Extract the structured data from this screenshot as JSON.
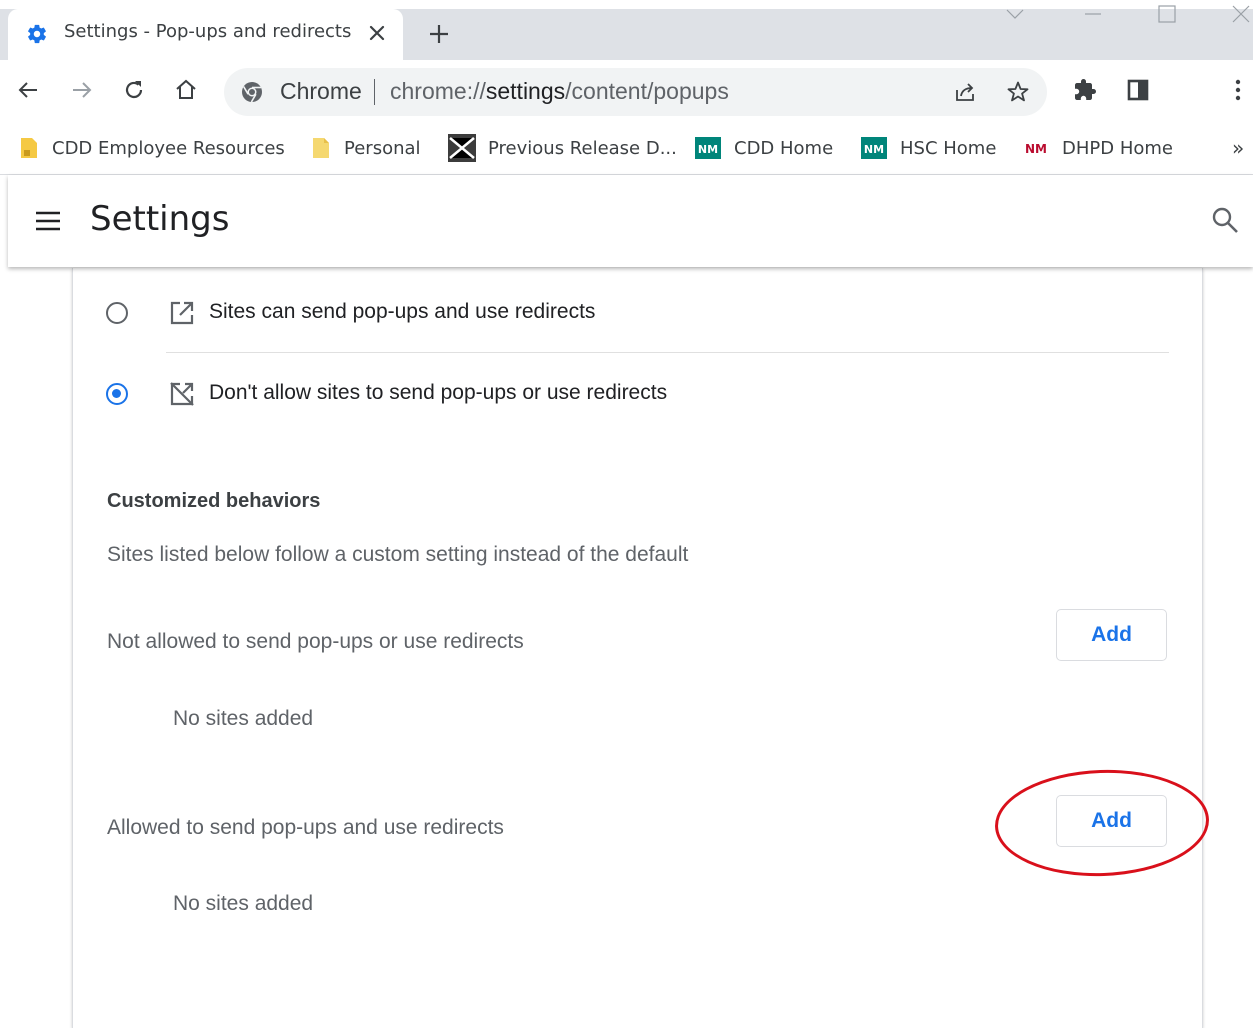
{
  "window": {
    "tab_title": "Settings - Pop-ups and redirects",
    "new_tab_symbol": "+",
    "close_symbol": "✕"
  },
  "toolbar": {
    "site_chip": "Chrome",
    "url_scheme": "chrome://",
    "url_host": "settings",
    "url_path": "/content/popups"
  },
  "bookmarks": [
    {
      "label": "CDD Employee Resources",
      "icon": "folder-icon"
    },
    {
      "label": "Personal",
      "icon": "folder-icon"
    },
    {
      "label": "Previous Release D...",
      "icon": "bookmark-site-icon"
    },
    {
      "label": "CDD Home",
      "icon": "unm-logo-icon"
    },
    {
      "label": "HSC Home",
      "icon": "unm-logo-icon"
    },
    {
      "label": "DHPD Home",
      "icon": "unm-logo-icon"
    }
  ],
  "bookmarks_overflow": "»",
  "settings": {
    "title": "Settings"
  },
  "options": [
    {
      "label": "Sites can send pop-ups and use redirects",
      "selected": false
    },
    {
      "label": "Don't allow sites to send pop-ups or use redirects",
      "selected": true
    }
  ],
  "customized": {
    "title": "Customized behaviors",
    "description": "Sites listed below follow a custom setting instead of the default",
    "blocked_label": "Not allowed to send pop-ups or use redirects",
    "blocked_empty": "No sites added",
    "blocked_add": "Add",
    "allowed_label": "Allowed to send pop-ups and use redirects",
    "allowed_empty": "No sites added",
    "allowed_add": "Add"
  },
  "colors": {
    "accent": "#1a73e8",
    "annotation": "#d9101b",
    "unm_teal": "#00857a",
    "unm_red": "#ba0c2f",
    "folder": "#f5c944"
  }
}
